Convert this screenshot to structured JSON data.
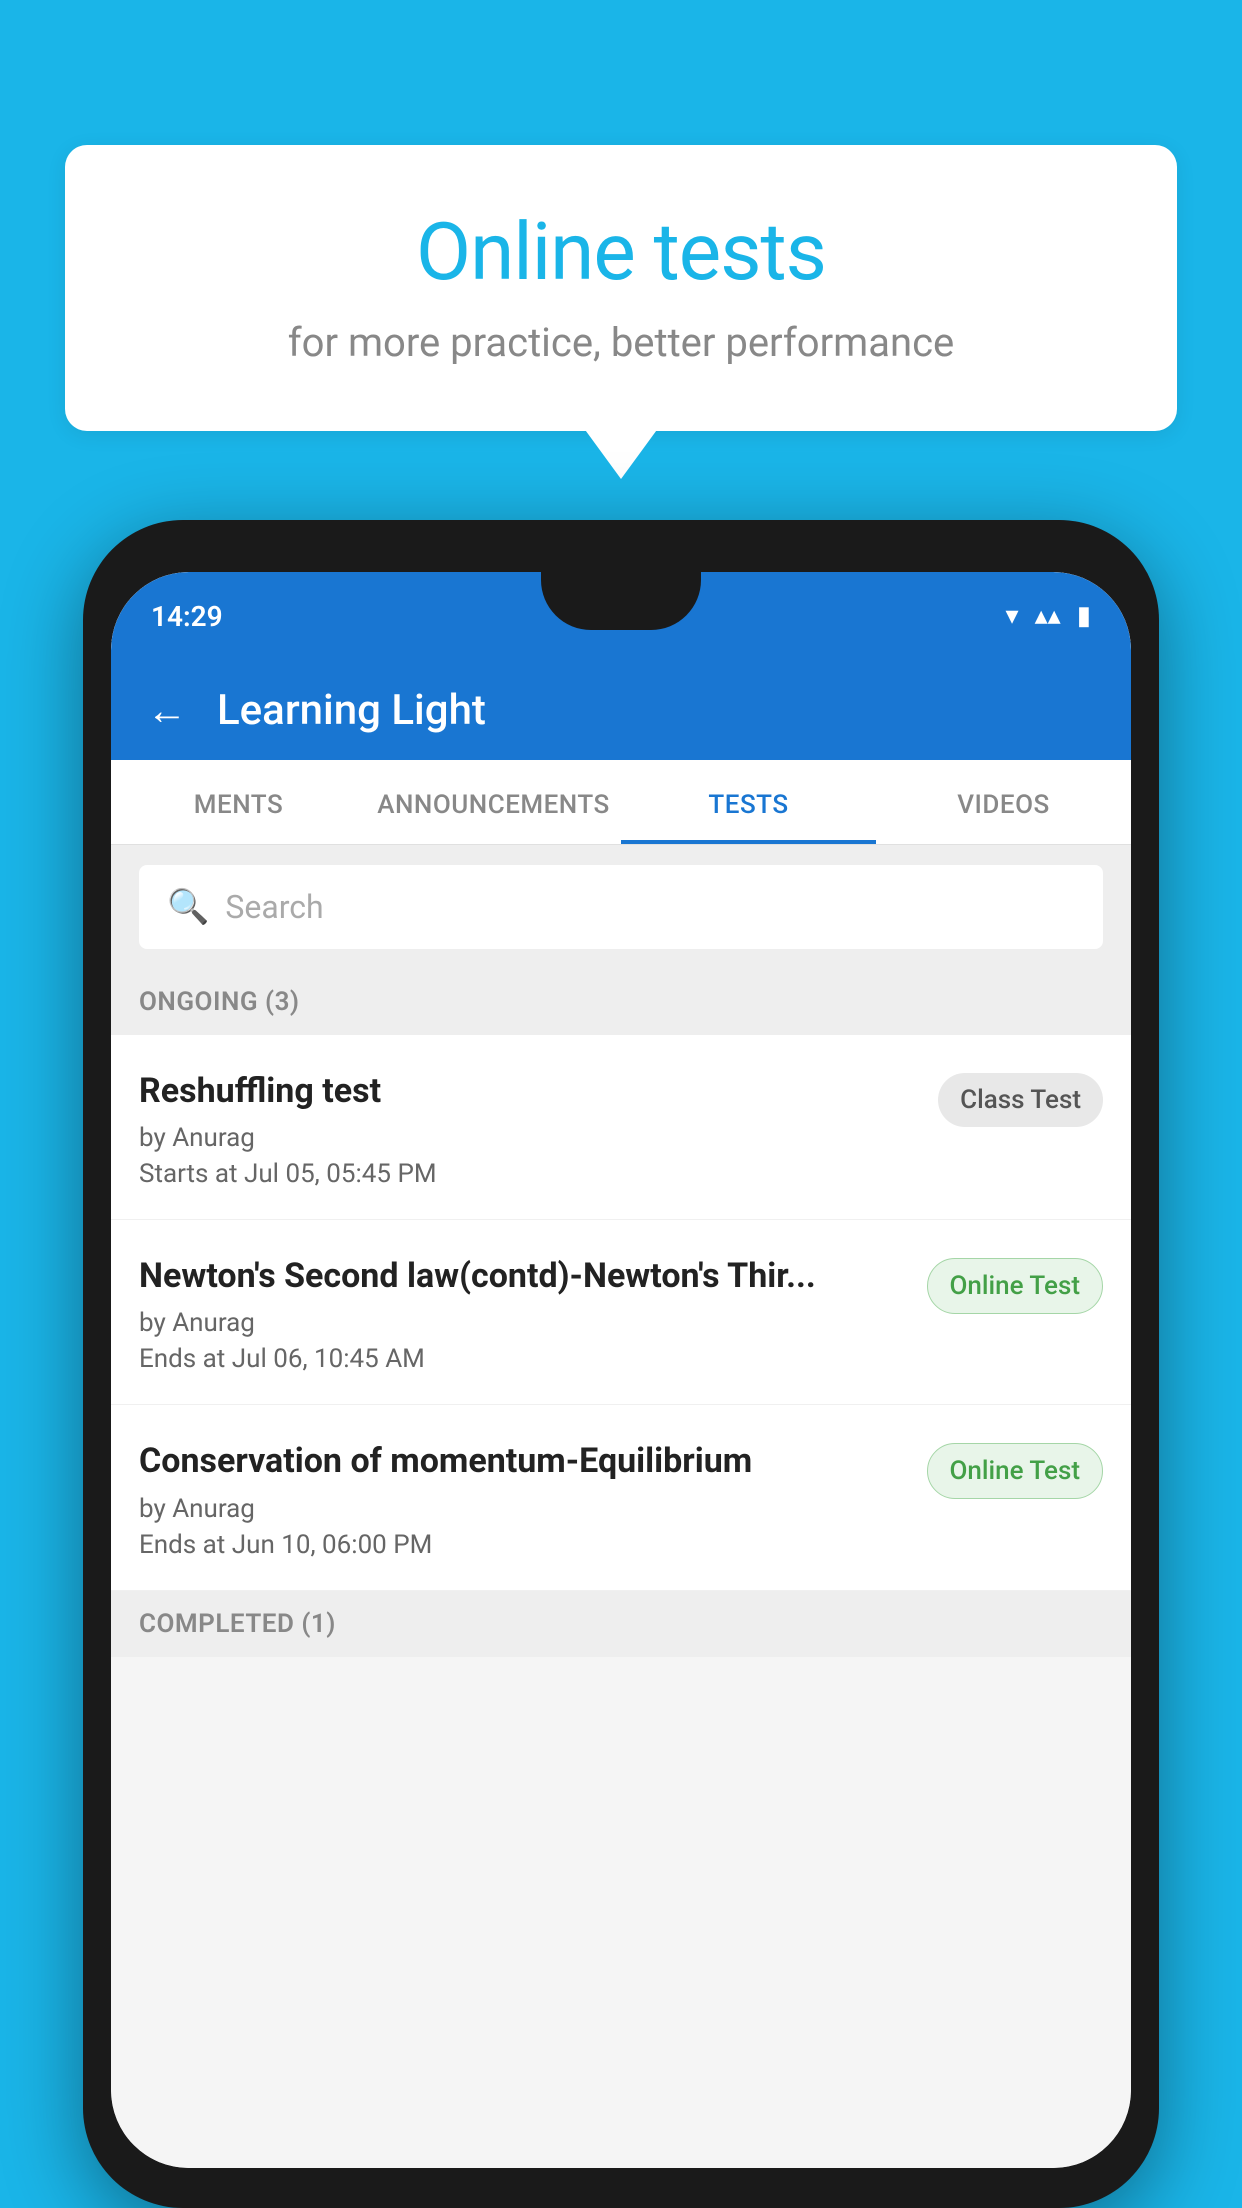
{
  "background": {
    "color": "#1ab5e8"
  },
  "speech_bubble": {
    "title": "Online tests",
    "subtitle": "for more practice, better performance"
  },
  "phone": {
    "status_bar": {
      "time": "14:29",
      "wifi_icon": "▼",
      "signal_icon": "▲",
      "battery_icon": "▮"
    },
    "app_header": {
      "back_label": "←",
      "title": "Learning Light"
    },
    "tabs": [
      {
        "label": "MENTS",
        "active": false
      },
      {
        "label": "ANNOUNCEMENTS",
        "active": false
      },
      {
        "label": "TESTS",
        "active": true
      },
      {
        "label": "VIDEOS",
        "active": false
      }
    ],
    "search": {
      "placeholder": "Search",
      "icon": "🔍"
    },
    "ongoing_section": {
      "label": "ONGOING (3)",
      "tests": [
        {
          "title": "Reshuffling test",
          "author": "by Anurag",
          "date": "Starts at  Jul 05, 05:45 PM",
          "badge": "Class Test",
          "badge_type": "class"
        },
        {
          "title": "Newton's Second law(contd)-Newton's Thir...",
          "author": "by Anurag",
          "date": "Ends at  Jul 06, 10:45 AM",
          "badge": "Online Test",
          "badge_type": "online"
        },
        {
          "title": "Conservation of momentum-Equilibrium",
          "author": "by Anurag",
          "date": "Ends at  Jun 10, 06:00 PM",
          "badge": "Online Test",
          "badge_type": "online"
        }
      ]
    },
    "completed_section": {
      "label": "COMPLETED (1)"
    }
  }
}
